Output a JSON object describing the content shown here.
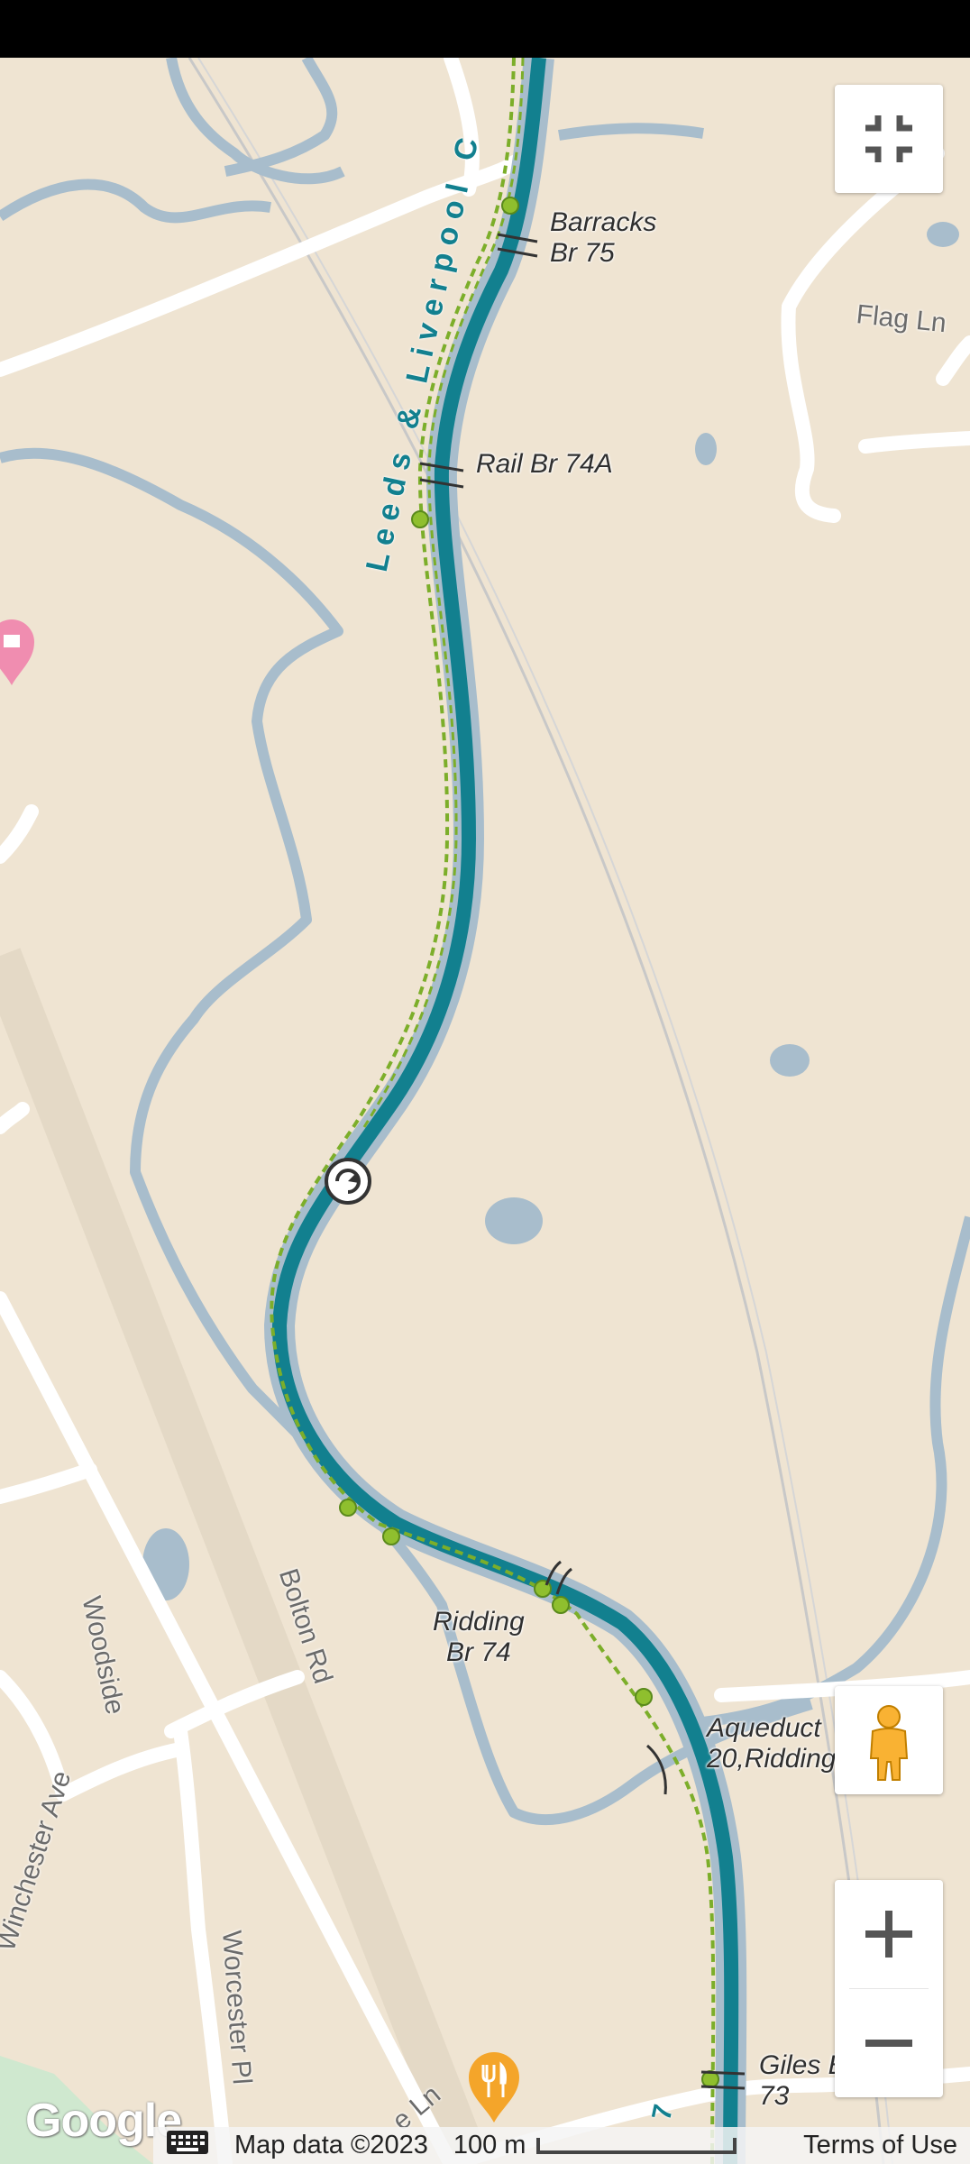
{
  "map": {
    "canal_name": "Leeds & Liverpool C",
    "labels": {
      "barracks_bridge_line1": "Barracks",
      "barracks_bridge_line2": "Br 75",
      "rail_bridge": "Rail Br 74A",
      "ridding_bridge_line1": "Ridding",
      "ridding_bridge_line2": "Br 74",
      "aqueduct_line1": "Aqueduct",
      "aqueduct_line2": "20,Ridding",
      "giles_bridge_line1": "Giles B",
      "giles_bridge_line2": "73",
      "canal_fragment": "7"
    },
    "roads": {
      "flag_ln": "Flag Ln",
      "woodside": "Woodside",
      "bolton_rd": "Bolton Rd",
      "winchester_ave": "Winchester Ave",
      "worcester_pl": "Worcester Pl",
      "fragment_ln": "e Ln"
    },
    "icons": {
      "fullscreen_exit": "fullscreen-exit-icon",
      "pegman": "pegman-icon",
      "zoom_in": "plus-icon",
      "zoom_out": "minus-icon",
      "poi_restaurant": "fork-knife-icon",
      "poi_pink": "pink-place-icon",
      "lock": "lock-icon",
      "keyboard": "keyboard-icon"
    }
  },
  "footer": {
    "logo": "Google",
    "map_data": "Map data ©2023",
    "scale": "100 m",
    "terms": "Terms of Use"
  },
  "colors": {
    "land": "#efe4d2",
    "water": "#a8bdcc",
    "canal": "#12808f",
    "towpath": "#7cae2a",
    "road": "#ffffff",
    "rail": "#e4d9c6",
    "park": "#cfe8cf"
  }
}
